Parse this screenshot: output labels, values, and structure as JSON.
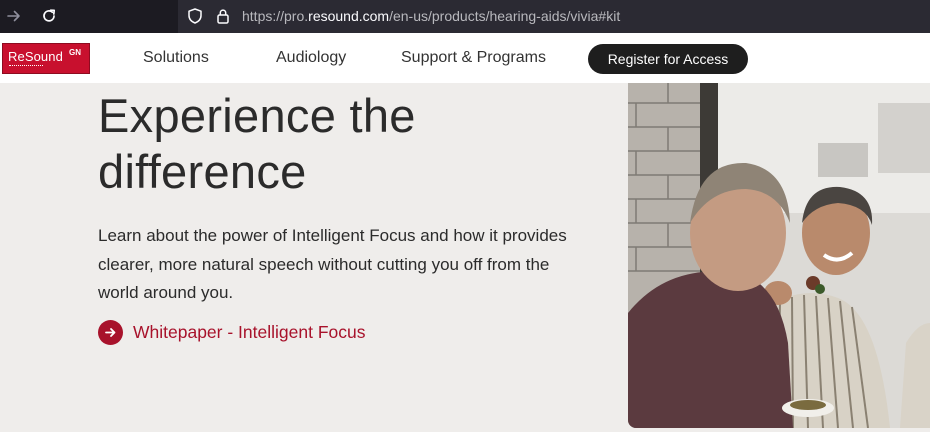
{
  "browser": {
    "url_prefix": "https://pro.",
    "url_host": "resound.com",
    "url_path": "/en-us/products/hearing-aids/vivia#kit",
    "icons": [
      "forward-arrow-icon",
      "reload-icon",
      "shield-icon",
      "lock-icon"
    ]
  },
  "header": {
    "logo_text": "ReSound",
    "logo_mark": "GN",
    "nav": [
      "Solutions",
      "Audiology",
      "Support & Programs"
    ],
    "cta": "Register for Access"
  },
  "hero": {
    "title_line1": "Experience the",
    "title_line2": "difference",
    "description": "Learn about the power of Intelligent Focus and how it provides clearer, more natural speech without cutting you off from the world around you.",
    "link_text": "Whitepaper - Intelligent Focus"
  },
  "colors": {
    "brand_red": "#c8102e",
    "link_red": "#a8122b",
    "hero_bg": "#efedeb",
    "browser_dark": "#1c1b22"
  }
}
